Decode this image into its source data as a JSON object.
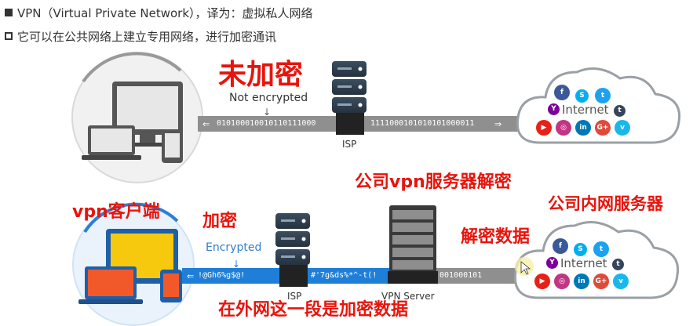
{
  "header": {
    "line1": "VPN（Virtual Private Network），译为：虚拟私人网络",
    "line2": "它可以在公共网络上建立专用网络，进行加密通讯"
  },
  "top_diagram": {
    "red_label": "未加密",
    "stream_label": "Not encrypted",
    "bits_left": "010100010010110111000",
    "bits_right": "1111000101010101000011",
    "isp_label": "ISP",
    "cloud_label": "Internet"
  },
  "bottom_diagram": {
    "client_label": "vpn客户端",
    "encrypt_label": "加密",
    "server_decrypt_label": "公司vpn服务器解密",
    "intranet_label": "公司内网服务器",
    "decrypt_label": "解密数据",
    "public_segment_label": "在外网这一段是加密数据",
    "stream_label": "Encrypted",
    "cipher_left": "!@Gh6%g$@!",
    "cipher_mid": "#'7g&ds%*^-t(!",
    "bits_right": "001000101",
    "isp_label": "ISP",
    "server_label": "VPN Server",
    "cloud_label": "Internet"
  },
  "social_icons": [
    "facebook-icon",
    "skype-icon",
    "twitter-icon",
    "yahoo-icon",
    "tumblr-icon",
    "youtube-icon",
    "instagram-icon",
    "linkedin-icon",
    "googleplus-icon",
    "vimeo-icon"
  ],
  "colors": {
    "red_label": "#e8140c",
    "encrypted_stream": "#1f7fd8",
    "plain_stream": "#8f8f8f",
    "server": "#2e3e4f"
  }
}
